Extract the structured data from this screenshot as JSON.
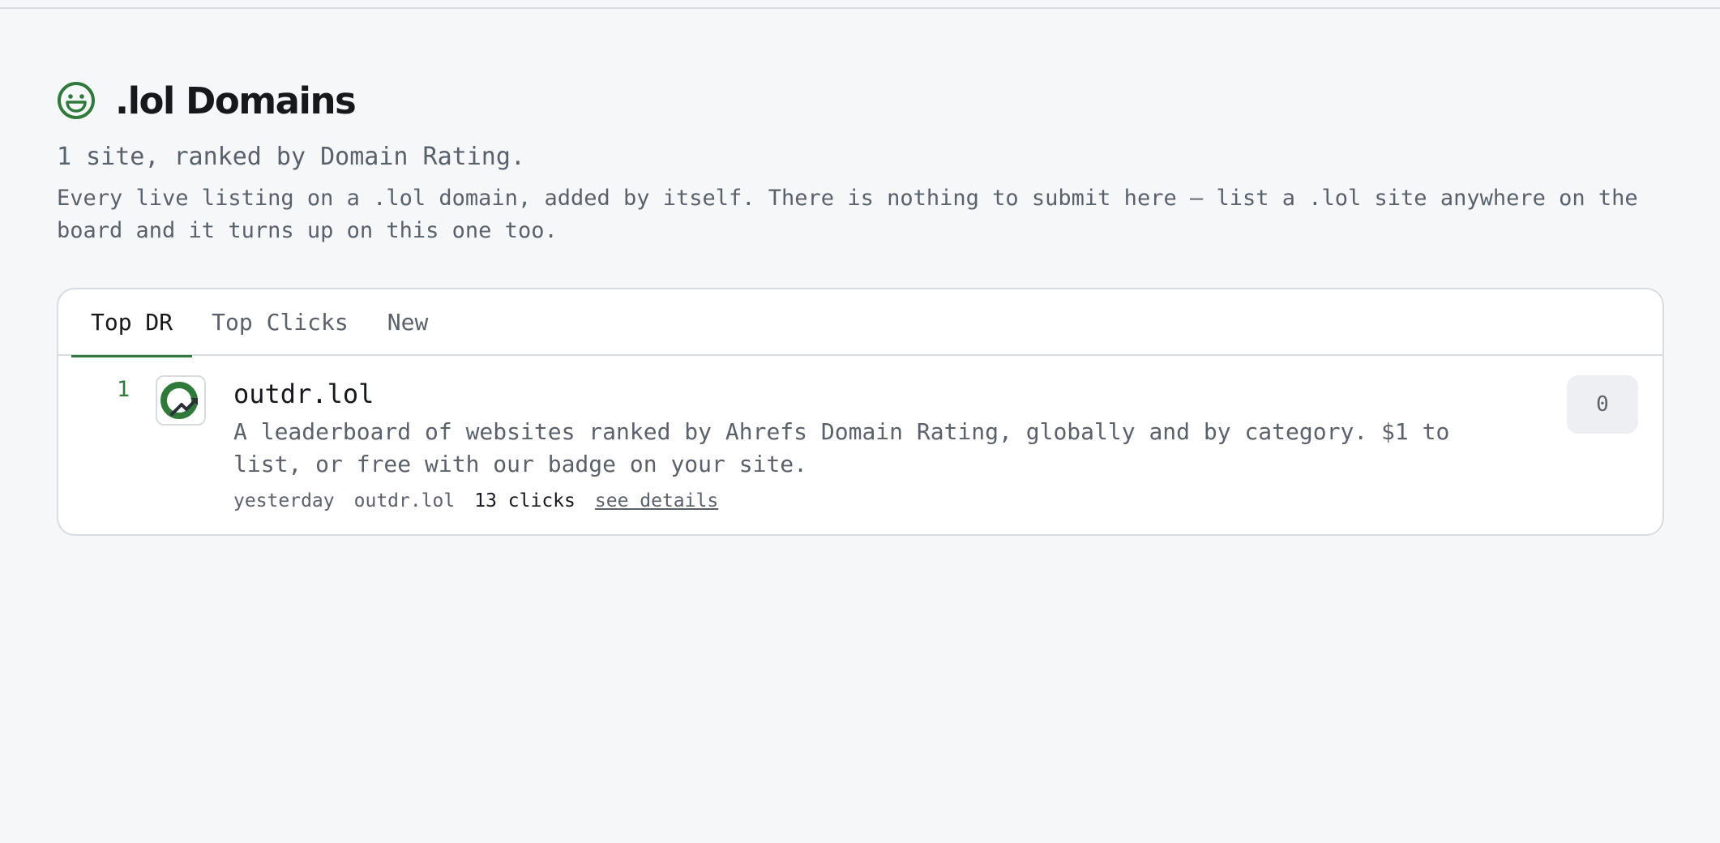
{
  "page": {
    "title": ".lol Domains",
    "subtitle": "1 site, ranked by Domain Rating.",
    "description": "Every live listing on a .lol domain, added by itself. There is nothing to submit here — list a .lol site anywhere on the board and it turns up on this one too.",
    "icon": "smiley-icon",
    "accent_color": "#2f7a3a"
  },
  "tabs": [
    {
      "label": "Top DR",
      "active": true
    },
    {
      "label": "Top Clicks",
      "active": false
    },
    {
      "label": "New",
      "active": false
    }
  ],
  "listings": [
    {
      "rank": "1",
      "name": "outdr.lol",
      "description": "A leaderboard of websites ranked by Ahrefs Domain Rating, globally and by category. $1 to list, or free with our badge on your site.",
      "added": "yesterday",
      "domain": "outdr.lol",
      "clicks": "13 clicks",
      "details_label": "see details",
      "votes": "0",
      "logo_icon": "outdr-logo-icon"
    }
  ]
}
